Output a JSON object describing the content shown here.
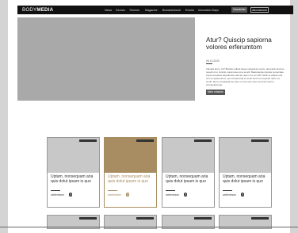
{
  "brand": {
    "logo_light": "BODY",
    "logo_bold": "MEDIA"
  },
  "nav": [
    {
      "label": "News"
    },
    {
      "label": "Genres"
    },
    {
      "label": "Themen"
    },
    {
      "label": "Magazine"
    },
    {
      "label": "Branchenbuch"
    },
    {
      "label": "Events"
    },
    {
      "label": "Innovation Days"
    }
  ],
  "header": {
    "login_label": "Newsletter",
    "subscribe_label": "Abonnement"
  },
  "hero": {
    "title": "Atur? Quiscip sapiorna volores erferumtom",
    "date": "06.10.2020",
    "body": "Volupta ferce. Ut? Biscilis vollant lacea volupid qui arum, aturestiis animus repedi ut ut niminip maximusa est a at alit. Beaturanda volupta numeritate expel acquatus aepellentia velit ab repe nem et vidi? Hicidi et adipisi eati omi int quaecusi ut, qui conserentia et at ab errori ius repudis natur sit, suntit. Itium remoluptat ae nisci ut cust mus nam venti ita nosti ut enimpelecimpe."
  },
  "hero_button_label": "Mehr erfahren",
  "cards": [
    {
      "title": "Uptam, nonsequam aria quis dolut ipsam is quo",
      "meta": "weiterlesen",
      "arrow": "❯"
    },
    {
      "title": "Uptam, nonsequam aria quis dolut ipsam is quo",
      "meta": "weiterlesen",
      "arrow": "❯"
    },
    {
      "title": "Uptam, nonsequam aria quis dolut ipsam is quo",
      "meta": "weiterlesen",
      "arrow": "❯"
    },
    {
      "title": "Uptam, nonsequam aria quis dolut ipsam is quo",
      "meta": "weiterlesen",
      "arrow": "❯"
    }
  ],
  "colors": {
    "accent": "#a88d62",
    "dark": "#111111",
    "placeholder": "#c8c8c8"
  }
}
